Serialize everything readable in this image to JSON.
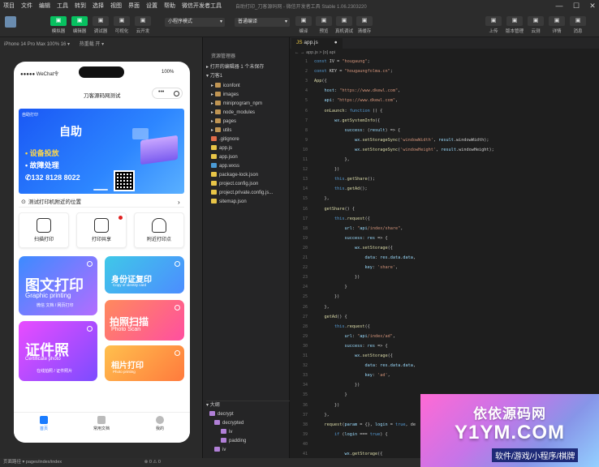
{
  "menubar": {
    "items": [
      "项目",
      "文件",
      "编辑",
      "工具",
      "转到",
      "选择",
      "视图",
      "界面",
      "设置",
      "帮助",
      "微信开发者工具"
    ],
    "title": "自助打印_刀客源码网 - 微信开发者工具 Stable 1.06.2303220"
  },
  "toolbar": {
    "left": [
      {
        "label": "模拟器",
        "icon": "phone-icon"
      },
      {
        "label": "编辑器",
        "icon": "code-icon"
      },
      {
        "label": "调试器",
        "icon": "debug-icon"
      },
      {
        "label": "可视化",
        "icon": "grid-icon"
      },
      {
        "label": "云开发",
        "icon": "cloud-icon"
      }
    ],
    "mode_select": "小程序模式",
    "compile_select": "普通编译",
    "center": [
      {
        "label": "编译",
        "icon": "refresh-icon"
      },
      {
        "label": "预览",
        "icon": "eye-icon"
      },
      {
        "label": "真机调试",
        "icon": "device-icon"
      },
      {
        "label": "清缓存",
        "icon": "layers-icon"
      }
    ],
    "right": [
      {
        "label": "上传",
        "icon": "upload-icon"
      },
      {
        "label": "版本管理",
        "icon": "branch-icon"
      },
      {
        "label": "云测",
        "icon": "test-icon"
      },
      {
        "label": "详情",
        "icon": "details-icon"
      },
      {
        "label": "消息",
        "icon": "bell-icon"
      }
    ]
  },
  "simulator": {
    "device": "iPhone 14 Pro Max 100% 16 ▾",
    "hot_reload": "热重载 开 ▾",
    "status_left": "●●●●● WeChat令",
    "status_right": "100%",
    "page_title": "刀客源码网测试",
    "banner": {
      "tag": "自助打印",
      "headline": "自助",
      "line1": "• 设备投放",
      "line2": "• 故障处理",
      "phone": "132 8128 8022"
    },
    "notice": "测试打印机附近的位置",
    "quick_actions": [
      "扫描打印",
      "打印共享",
      "附近打印点"
    ],
    "cards": [
      {
        "big": "图文打印",
        "en": "Graphic printing",
        "desc": "微信 文档 / 网页打印"
      },
      {
        "big": "身份证复印",
        "en": "Copy of identity card"
      },
      {
        "big": "拍照扫描",
        "en": "Photo Scan"
      },
      {
        "big": "证件照",
        "en": "Certificate photo",
        "desc": "在线拍照 / 证件照片"
      },
      {
        "big": "相片打印",
        "en": "Photo printing"
      }
    ],
    "tabs": [
      "首页",
      "常用文档",
      "我的"
    ]
  },
  "explorer": {
    "header": "资源管理器",
    "open_editors": "打开的编辑器   1 个未保存",
    "root": "刀客1",
    "files": [
      {
        "name": "iconfont",
        "type": "folder"
      },
      {
        "name": "images",
        "type": "folder"
      },
      {
        "name": "miniprogram_npm",
        "type": "folder"
      },
      {
        "name": "node_modules",
        "type": "folder"
      },
      {
        "name": "pages",
        "type": "folder"
      },
      {
        "name": "utils",
        "type": "folder"
      },
      {
        "name": ".gitignore",
        "type": "git"
      },
      {
        "name": "app.js",
        "type": "js"
      },
      {
        "name": "app.json",
        "type": "json"
      },
      {
        "name": "app.wxss",
        "type": "wxss"
      },
      {
        "name": "package-lock.json",
        "type": "json"
      },
      {
        "name": "project.config.json",
        "type": "json"
      },
      {
        "name": "project.private.config.js...",
        "type": "json"
      },
      {
        "name": "sitemap.json",
        "type": "json"
      }
    ],
    "outline_header": "大纲",
    "outline": [
      "decrypt",
      "decrypted",
      "iv",
      "padding",
      "iv"
    ]
  },
  "editor": {
    "tab": "app.js",
    "crumb": "app.js > [o] api",
    "lines": [
      {
        "n": "1",
        "t": "const IV = \"hougaung\";"
      },
      {
        "n": "2",
        "t": "const KEY = \"hougaungfolma.cn\";"
      },
      {
        "n": "3",
        "t": "App({"
      },
      {
        "n": "4",
        "t": "    host: \"https://www.dkewl.com\","
      },
      {
        "n": "5",
        "t": "    api: \"https://www.dkewl.com\","
      },
      {
        "n": "6",
        "t": "    onLaunch: function () {"
      },
      {
        "n": "7",
        "t": "        wx.getSystemInfo({"
      },
      {
        "n": "8",
        "t": "            success: (result) => {"
      },
      {
        "n": "9",
        "t": "                wx.setStorageSync('windowWidth', result.windowWidth);"
      },
      {
        "n": "10",
        "t": "                wx.setStorageSync('windowHeight', result.windowHeight);"
      },
      {
        "n": "11",
        "t": "            },"
      },
      {
        "n": "12",
        "t": "        })"
      },
      {
        "n": "13",
        "t": "        this.getShare();"
      },
      {
        "n": "14",
        "t": "        this.getAd();"
      },
      {
        "n": "15",
        "t": "    },"
      },
      {
        "n": "16",
        "t": "    getShare() {"
      },
      {
        "n": "17",
        "t": "        this.request({"
      },
      {
        "n": "18",
        "t": "            url: \"api/index/share\","
      },
      {
        "n": "19",
        "t": "            success: res => {"
      },
      {
        "n": "20",
        "t": "                wx.setStorage({"
      },
      {
        "n": "21",
        "t": "                    data: res.data.data,"
      },
      {
        "n": "22",
        "t": "                    key: 'share',"
      },
      {
        "n": "23",
        "t": "                })"
      },
      {
        "n": "24",
        "t": "            }"
      },
      {
        "n": "25",
        "t": "        })"
      },
      {
        "n": "26",
        "t": "    },"
      },
      {
        "n": "27",
        "t": "    getAd() {"
      },
      {
        "n": "28",
        "t": "        this.request({"
      },
      {
        "n": "29",
        "t": "            url: \"api/index/ad\","
      },
      {
        "n": "30",
        "t": "            success: res => {"
      },
      {
        "n": "31",
        "t": "                wx.setStorage({"
      },
      {
        "n": "32",
        "t": "                    data: res.data.data,"
      },
      {
        "n": "33",
        "t": "                    key: 'ad',"
      },
      {
        "n": "34",
        "t": "                })"
      },
      {
        "n": "35",
        "t": "            }"
      },
      {
        "n": "36",
        "t": "        })"
      },
      {
        "n": "37",
        "t": "    },"
      },
      {
        "n": "38",
        "t": "    request(param = {}, login = true, de"
      },
      {
        "n": "39",
        "t": "        if (login === true) {"
      },
      {
        "n": "40",
        "t": ""
      },
      {
        "n": "41",
        "t": "            wx.getStorage({"
      }
    ]
  },
  "statusbar": {
    "left": "页面路径 ▾   pages/index/index",
    "mid": "⊗ 0 ⚠ 0"
  },
  "watermark": {
    "line1": "依依源码网",
    "line2": "Y1YM.COM",
    "line3": "软件/游戏/小程序/棋牌"
  }
}
